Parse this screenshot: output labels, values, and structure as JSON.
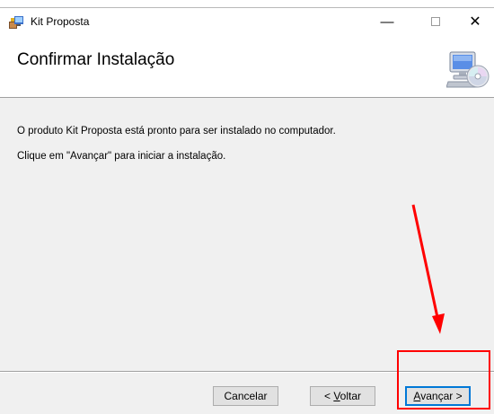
{
  "window": {
    "title": "Kit Proposta",
    "minimize_glyph": "—",
    "close_glyph": "✕"
  },
  "header": {
    "title": "Confirmar Instalação",
    "icon": "setup-computer-disc-icon"
  },
  "content": {
    "line1": "O produto Kit Proposta está pronto para ser instalado no computador.",
    "line2": "Clique em \"Avançar\" para iniciar a instalação."
  },
  "buttons": {
    "cancel": "Cancelar",
    "back_prefix": "< ",
    "back_accel": "V",
    "back_rest": "oltar",
    "next_accel": "A",
    "next_rest": "vançar >"
  },
  "annotation": {
    "color": "#ff0000"
  },
  "colors": {
    "accent": "#0078d7",
    "dialog_bg": "#f0f0f0"
  }
}
